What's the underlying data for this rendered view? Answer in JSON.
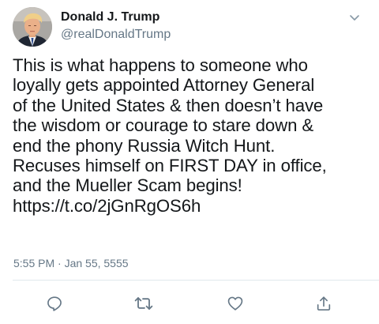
{
  "author": {
    "display_name": "Donald J. Trump",
    "handle": "@realDonaldTrump",
    "avatar_icon": "profile-photo"
  },
  "tweet": {
    "text": "This is what happens to someone who\nloyally gets appointed Attorney General\nof the United States & then doesn’t have\nthe wisdom or courage to stare down &\nend the phony Russia Witch Hunt.\nRecuses himself on FIRST DAY in office,\nand the Mueller Scam begins!\nhttps://t.co/2jGnRgOS6h",
    "timestamp": "5:55 PM · Jan 55, 5555"
  },
  "actions": [
    {
      "icon": "reply-icon"
    },
    {
      "icon": "retweet-icon"
    },
    {
      "icon": "like-icon"
    },
    {
      "icon": "share-icon"
    }
  ],
  "colors": {
    "text": "#14171a",
    "secondary": "#657786",
    "divider": "#e1e8ed"
  }
}
